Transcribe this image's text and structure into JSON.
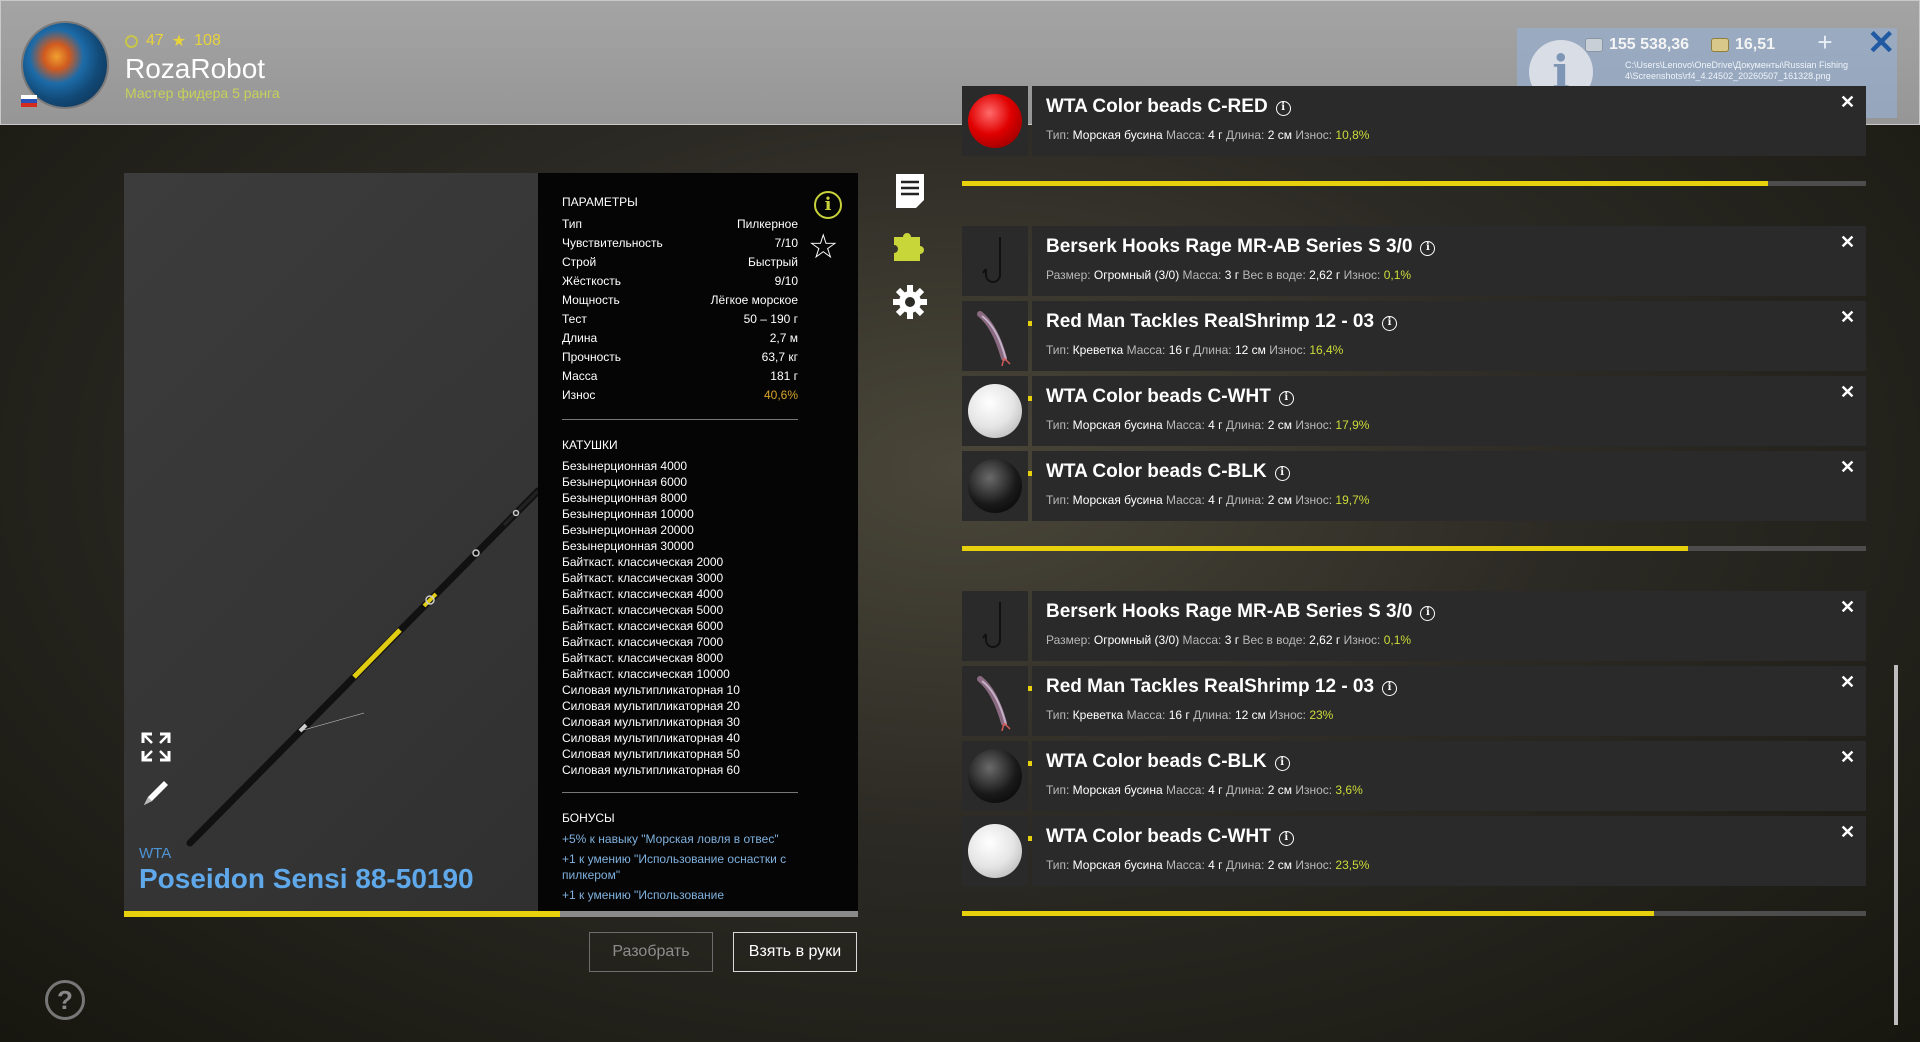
{
  "player": {
    "level": "47",
    "stars": "108",
    "username": "RozaRobot",
    "rank": "Мастер фидера 5 ранга"
  },
  "currency": {
    "silver": "155 538,36",
    "gold": "16,51"
  },
  "screenshot_notice": {
    "path": "C:\\Users\\Lenovo\\OneDrive\\Документы\\Russian Fishing 4\\Screenshots\\rf4_4.24502_20260507_161328.png"
  },
  "rod": {
    "brand": "WTA",
    "model": "Poseidon Sensi 88-50190",
    "wear_fraction": 0.594,
    "params_title": "ПАРАМЕТРЫ",
    "params": [
      {
        "label": "Тип",
        "value": "Пилкерное"
      },
      {
        "label": "Чувствительность",
        "value": "7/10"
      },
      {
        "label": "Строй",
        "value": "Быстрый"
      },
      {
        "label": "Жёсткость",
        "value": "9/10"
      },
      {
        "label": "Мощность",
        "value": "Лёгкое морское"
      },
      {
        "label": "Тест",
        "value": "50 – 190 г"
      },
      {
        "label": "Длина",
        "value": "2,7 м"
      },
      {
        "label": "Прочность",
        "value": "63,7 кг"
      },
      {
        "label": "Масса",
        "value": "181 г"
      },
      {
        "label": "Износ",
        "value": "40,6%"
      }
    ],
    "reels_title": "КАТУШКИ",
    "reels": [
      "Безынерционная 4000",
      "Безынерционная 6000",
      "Безынерционная 8000",
      "Безынерционная 10000",
      "Безынерционная 20000",
      "Безынерционная 30000",
      "Байткаст. классическая 2000",
      "Байткаст. классическая 3000",
      "Байткаст. классическая 4000",
      "Байткаст. классическая 5000",
      "Байткаст. классическая 6000",
      "Байткаст. классическая 7000",
      "Байткаст. классическая 8000",
      "Байткаст. классическая 10000",
      "Силовая мультипликаторная 10",
      "Силовая мультипликаторная 20",
      "Силовая мультипликаторная 30",
      "Силовая мультипликаторная 40",
      "Силовая мультипликаторная 50",
      "Силовая мультипликаторная 60"
    ],
    "bonuses_title": "БОНУСЫ",
    "bonuses": [
      "+5% к навыку \"Морская ловля в отвес\"",
      "+1 к умению \"Использование оснастки с пилкером\"",
      "+1 к умению \"Использование"
    ]
  },
  "buttons": {
    "disassemble": "Разобрать",
    "take": "Взять в руки",
    "help": "?"
  },
  "labels": {
    "type": "Тип:",
    "size": "Размер:",
    "mass": "Масса:",
    "length": "Длина:",
    "weight_in_water": "Вес в воде:",
    "wear": "Износ:"
  },
  "items": [
    {
      "name": "WTA Color beads C-RED",
      "kind": "bead-red",
      "f1": "Морская бусина",
      "mass": "4 г",
      "f3label": "Длина:",
      "f3": "2 см",
      "wear": "10,8%",
      "condition": 0.892,
      "f1label": "Тип:"
    },
    {
      "name": "Berserk Hooks Rage MR-AB Series S 3/0",
      "kind": "hook",
      "f1label": "Размер:",
      "f1": "Огромный (3/0)",
      "mass": "3 г",
      "f3label": "Вес в воде:",
      "f3": "2,62 г",
      "wear": "0,1%",
      "condition": 0.999
    },
    {
      "name": "Red Man Tackles RealShrimp 12 - 03",
      "kind": "shrimp",
      "f1label": "Тип:",
      "f1": "Креветка",
      "mass": "16 г",
      "f3label": "Длина:",
      "f3": "12 см",
      "wear": "16,4%",
      "condition": 0.836
    },
    {
      "name": "WTA Color beads C-WHT",
      "kind": "bead-white",
      "f1label": "Тип:",
      "f1": "Морская бусина",
      "mass": "4 г",
      "f3label": "Длина:",
      "f3": "2 см",
      "wear": "17,9%",
      "condition": 0.821
    },
    {
      "name": "WTA Color beads C-BLK",
      "kind": "bead-black",
      "f1label": "Тип:",
      "f1": "Морская бусина",
      "mass": "4 г",
      "f3label": "Длина:",
      "f3": "2 см",
      "wear": "19,7%",
      "condition": 0.803
    },
    {
      "name": "Berserk Hooks Rage MR-AB Series S 3/0",
      "kind": "hook",
      "f1label": "Размер:",
      "f1": "Огромный (3/0)",
      "mass": "3 г",
      "f3label": "Вес в воде:",
      "f3": "2,62 г",
      "wear": "0,1%",
      "condition": 0.999
    },
    {
      "name": "Red Man Tackles RealShrimp 12 - 03",
      "kind": "shrimp",
      "f1label": "Тип:",
      "f1": "Креветка",
      "mass": "16 г",
      "f3label": "Длина:",
      "f3": "12 см",
      "wear": "23%",
      "condition": 0.77
    },
    {
      "name": "WTA Color beads C-BLK",
      "kind": "bead-black",
      "f1label": "Тип:",
      "f1": "Морская бусина",
      "mass": "4 г",
      "f3label": "Длина:",
      "f3": "2 см",
      "wear": "3,6%",
      "condition": 0.964
    },
    {
      "name": "WTA Color beads C-WHT",
      "kind": "bead-white",
      "f1label": "Тип:",
      "f1": "Морская бусина",
      "mass": "4 г",
      "f3label": "Длина:",
      "f3": "2 см",
      "wear": "23,5%",
      "condition": 0.765
    }
  ]
}
